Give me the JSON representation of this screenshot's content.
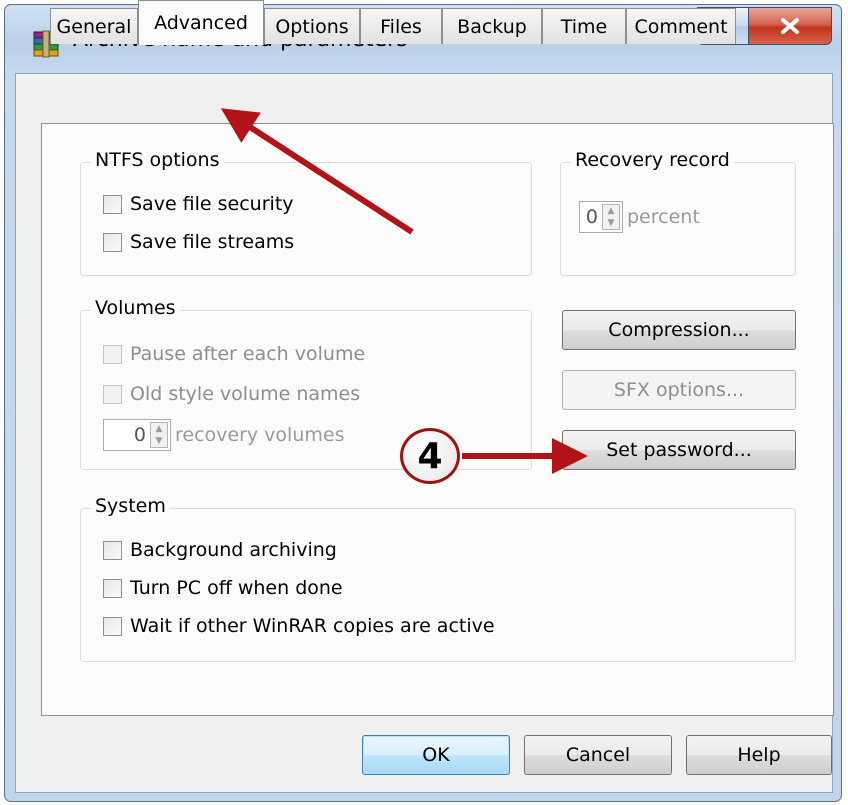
{
  "window": {
    "title": "Archive name and parameters",
    "help_glyph": "?",
    "close_glyph": "X"
  },
  "tabs": [
    {
      "label": "General"
    },
    {
      "label": "Advanced",
      "active": true
    },
    {
      "label": "Options"
    },
    {
      "label": "Files"
    },
    {
      "label": "Backup"
    },
    {
      "label": "Time"
    },
    {
      "label": "Comment"
    }
  ],
  "ntfs": {
    "title": "NTFS options",
    "save_security": "Save file security",
    "save_streams": "Save file streams"
  },
  "recovery": {
    "title": "Recovery record",
    "value": "0",
    "unit": "percent"
  },
  "volumes": {
    "title": "Volumes",
    "pause": "Pause after each volume",
    "old_names": "Old style volume names",
    "recovery_value": "0",
    "recovery_unit": "recovery volumes"
  },
  "buttons": {
    "compression": "Compression...",
    "sfx": "SFX options...",
    "password": "Set password...",
    "ok": "OK",
    "cancel": "Cancel",
    "help": "Help"
  },
  "system": {
    "title": "System",
    "background": "Background archiving",
    "turn_off": "Turn PC off when done",
    "wait": "Wait if other WinRAR copies are active"
  },
  "annotation": {
    "step_number": "4",
    "arrow_color": "#b31217"
  }
}
